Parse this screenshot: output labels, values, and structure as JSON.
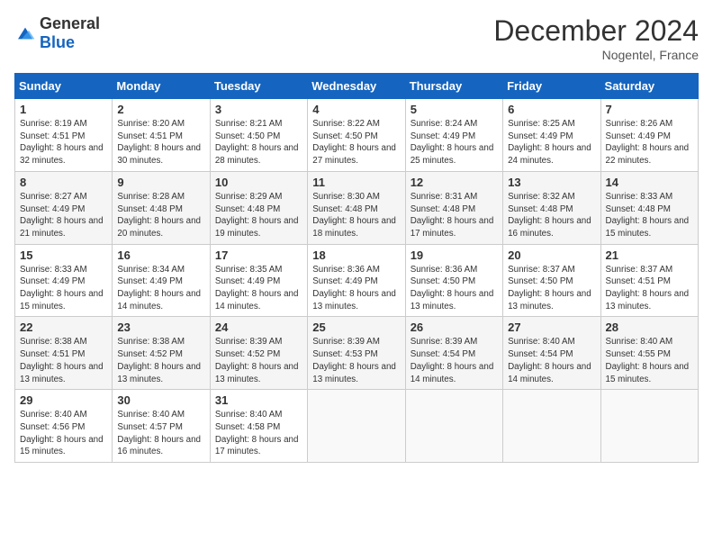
{
  "logo": {
    "general": "General",
    "blue": "Blue"
  },
  "title": "December 2024",
  "location": "Nogentel, France",
  "days_of_week": [
    "Sunday",
    "Monday",
    "Tuesday",
    "Wednesday",
    "Thursday",
    "Friday",
    "Saturday"
  ],
  "weeks": [
    [
      {
        "day": "1",
        "sunrise": "8:19 AM",
        "sunset": "4:51 PM",
        "daylight": "8 hours and 32 minutes."
      },
      {
        "day": "2",
        "sunrise": "8:20 AM",
        "sunset": "4:51 PM",
        "daylight": "8 hours and 30 minutes."
      },
      {
        "day": "3",
        "sunrise": "8:21 AM",
        "sunset": "4:50 PM",
        "daylight": "8 hours and 28 minutes."
      },
      {
        "day": "4",
        "sunrise": "8:22 AM",
        "sunset": "4:50 PM",
        "daylight": "8 hours and 27 minutes."
      },
      {
        "day": "5",
        "sunrise": "8:24 AM",
        "sunset": "4:49 PM",
        "daylight": "8 hours and 25 minutes."
      },
      {
        "day": "6",
        "sunrise": "8:25 AM",
        "sunset": "4:49 PM",
        "daylight": "8 hours and 24 minutes."
      },
      {
        "day": "7",
        "sunrise": "8:26 AM",
        "sunset": "4:49 PM",
        "daylight": "8 hours and 22 minutes."
      }
    ],
    [
      {
        "day": "8",
        "sunrise": "8:27 AM",
        "sunset": "4:49 PM",
        "daylight": "8 hours and 21 minutes."
      },
      {
        "day": "9",
        "sunrise": "8:28 AM",
        "sunset": "4:48 PM",
        "daylight": "8 hours and 20 minutes."
      },
      {
        "day": "10",
        "sunrise": "8:29 AM",
        "sunset": "4:48 PM",
        "daylight": "8 hours and 19 minutes."
      },
      {
        "day": "11",
        "sunrise": "8:30 AM",
        "sunset": "4:48 PM",
        "daylight": "8 hours and 18 minutes."
      },
      {
        "day": "12",
        "sunrise": "8:31 AM",
        "sunset": "4:48 PM",
        "daylight": "8 hours and 17 minutes."
      },
      {
        "day": "13",
        "sunrise": "8:32 AM",
        "sunset": "4:48 PM",
        "daylight": "8 hours and 16 minutes."
      },
      {
        "day": "14",
        "sunrise": "8:33 AM",
        "sunset": "4:48 PM",
        "daylight": "8 hours and 15 minutes."
      }
    ],
    [
      {
        "day": "15",
        "sunrise": "8:33 AM",
        "sunset": "4:49 PM",
        "daylight": "8 hours and 15 minutes."
      },
      {
        "day": "16",
        "sunrise": "8:34 AM",
        "sunset": "4:49 PM",
        "daylight": "8 hours and 14 minutes."
      },
      {
        "day": "17",
        "sunrise": "8:35 AM",
        "sunset": "4:49 PM",
        "daylight": "8 hours and 14 minutes."
      },
      {
        "day": "18",
        "sunrise": "8:36 AM",
        "sunset": "4:49 PM",
        "daylight": "8 hours and 13 minutes."
      },
      {
        "day": "19",
        "sunrise": "8:36 AM",
        "sunset": "4:50 PM",
        "daylight": "8 hours and 13 minutes."
      },
      {
        "day": "20",
        "sunrise": "8:37 AM",
        "sunset": "4:50 PM",
        "daylight": "8 hours and 13 minutes."
      },
      {
        "day": "21",
        "sunrise": "8:37 AM",
        "sunset": "4:51 PM",
        "daylight": "8 hours and 13 minutes."
      }
    ],
    [
      {
        "day": "22",
        "sunrise": "8:38 AM",
        "sunset": "4:51 PM",
        "daylight": "8 hours and 13 minutes."
      },
      {
        "day": "23",
        "sunrise": "8:38 AM",
        "sunset": "4:52 PM",
        "daylight": "8 hours and 13 minutes."
      },
      {
        "day": "24",
        "sunrise": "8:39 AM",
        "sunset": "4:52 PM",
        "daylight": "8 hours and 13 minutes."
      },
      {
        "day": "25",
        "sunrise": "8:39 AM",
        "sunset": "4:53 PM",
        "daylight": "8 hours and 13 minutes."
      },
      {
        "day": "26",
        "sunrise": "8:39 AM",
        "sunset": "4:54 PM",
        "daylight": "8 hours and 14 minutes."
      },
      {
        "day": "27",
        "sunrise": "8:40 AM",
        "sunset": "4:54 PM",
        "daylight": "8 hours and 14 minutes."
      },
      {
        "day": "28",
        "sunrise": "8:40 AM",
        "sunset": "4:55 PM",
        "daylight": "8 hours and 15 minutes."
      }
    ],
    [
      {
        "day": "29",
        "sunrise": "8:40 AM",
        "sunset": "4:56 PM",
        "daylight": "8 hours and 15 minutes."
      },
      {
        "day": "30",
        "sunrise": "8:40 AM",
        "sunset": "4:57 PM",
        "daylight": "8 hours and 16 minutes."
      },
      {
        "day": "31",
        "sunrise": "8:40 AM",
        "sunset": "4:58 PM",
        "daylight": "8 hours and 17 minutes."
      },
      null,
      null,
      null,
      null
    ]
  ]
}
